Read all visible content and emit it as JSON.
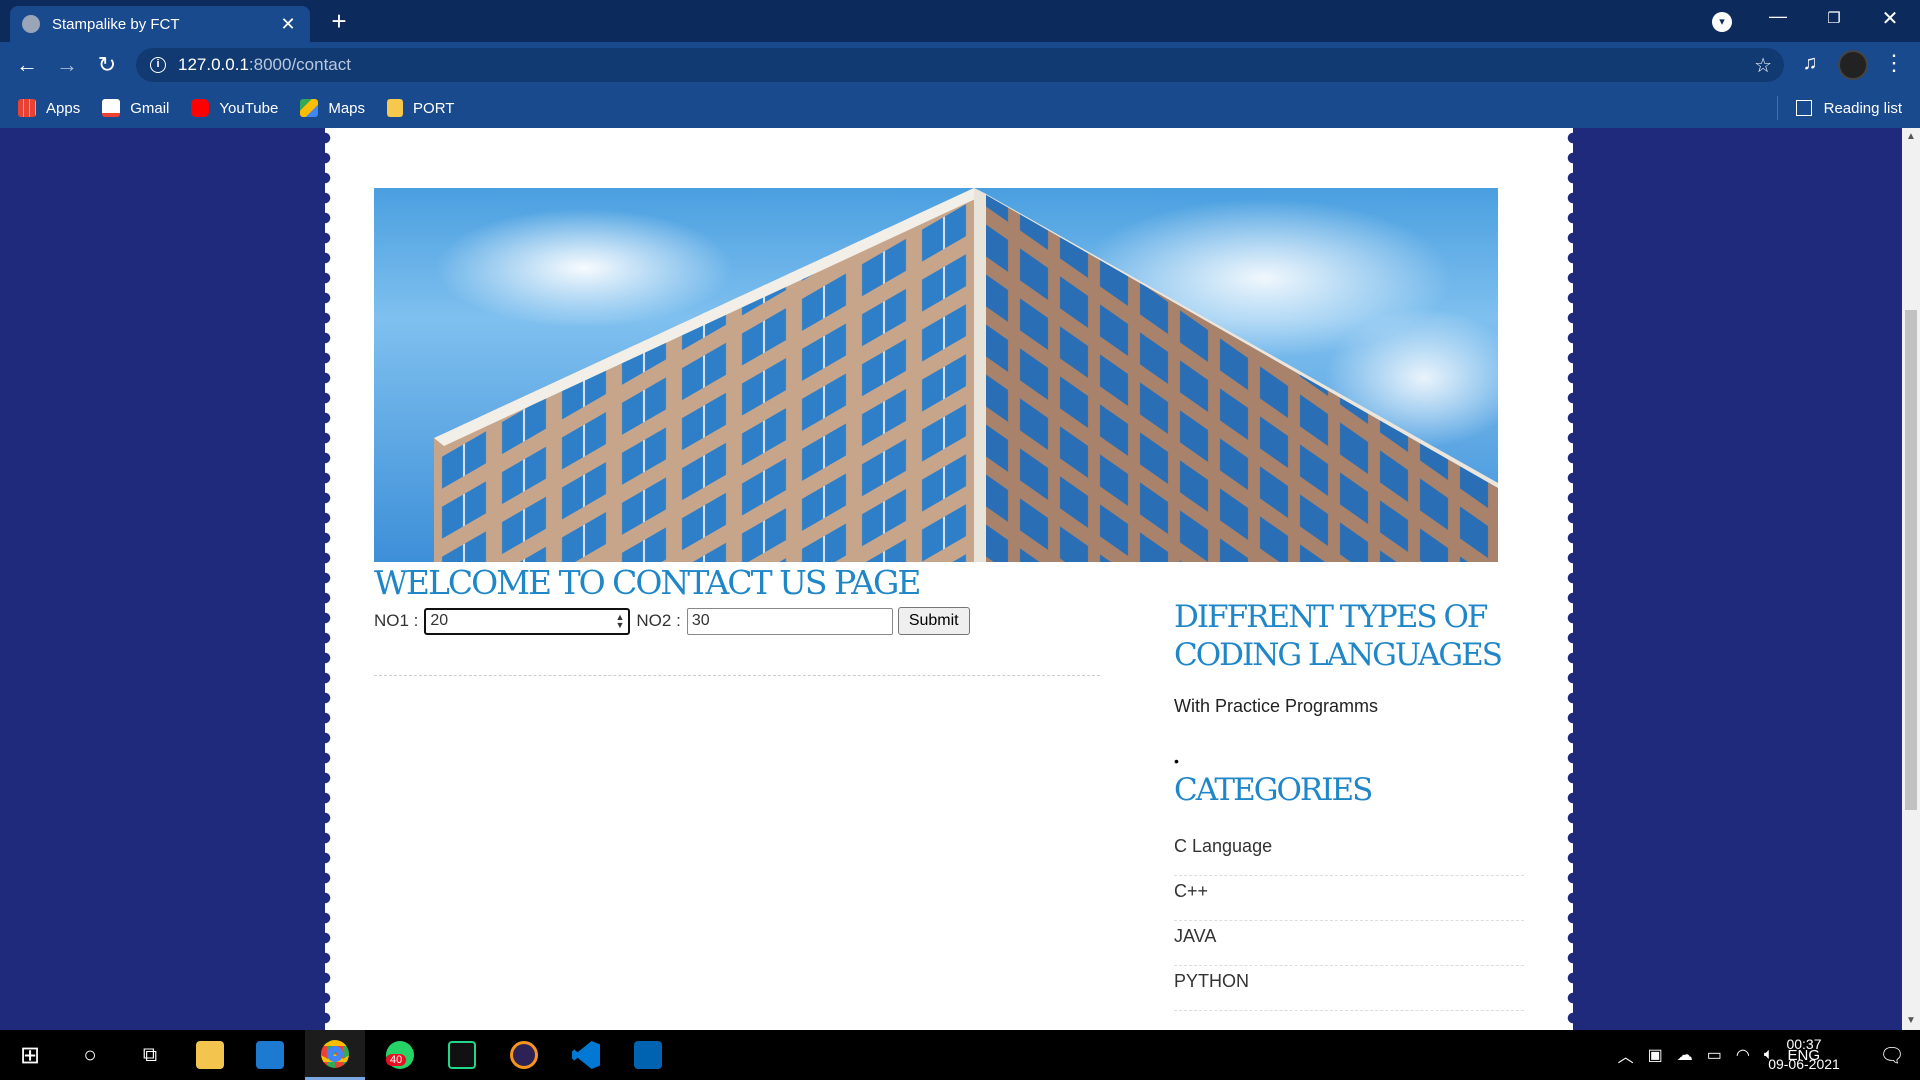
{
  "browser": {
    "tab_title": "Stampalike by FCT",
    "tab_close": "✕",
    "new_tab": "+",
    "url_host": "127.0.0.1",
    "url_path": ":8000/contact",
    "window_minimize": "—",
    "window_maximize": "❐",
    "window_close": "✕"
  },
  "bookmarks": {
    "items": [
      "Apps",
      "Gmail",
      "YouTube",
      "Maps",
      "PORT"
    ],
    "reading_list": "Reading list"
  },
  "page": {
    "welcome_heading": "WELCOME TO CONTACT US PAGE",
    "form": {
      "no1_label": "NO1 :",
      "no1_value": "20",
      "no2_label": "NO2 :",
      "no2_value": "30",
      "submit_label": "Submit"
    },
    "sidebar": {
      "title": "DIFFRENT TYPES OF CODING LANGUAGES",
      "description": "With Practice Programms",
      "bullet": "•",
      "categories_title": "CATEGORIES",
      "categories": [
        "C Language",
        "C++",
        "JAVA",
        "PYTHON"
      ]
    }
  },
  "taskbar": {
    "whatsapp_badge": "40",
    "language": "ENG",
    "time": "00:37",
    "date": "09-06-2021"
  },
  "colors": {
    "page_background": "#1f2a7c",
    "heading_blue": "#1f86c7",
    "chrome_dark": "#0d2a5c",
    "chrome_toolbar": "#1a4a8e"
  }
}
